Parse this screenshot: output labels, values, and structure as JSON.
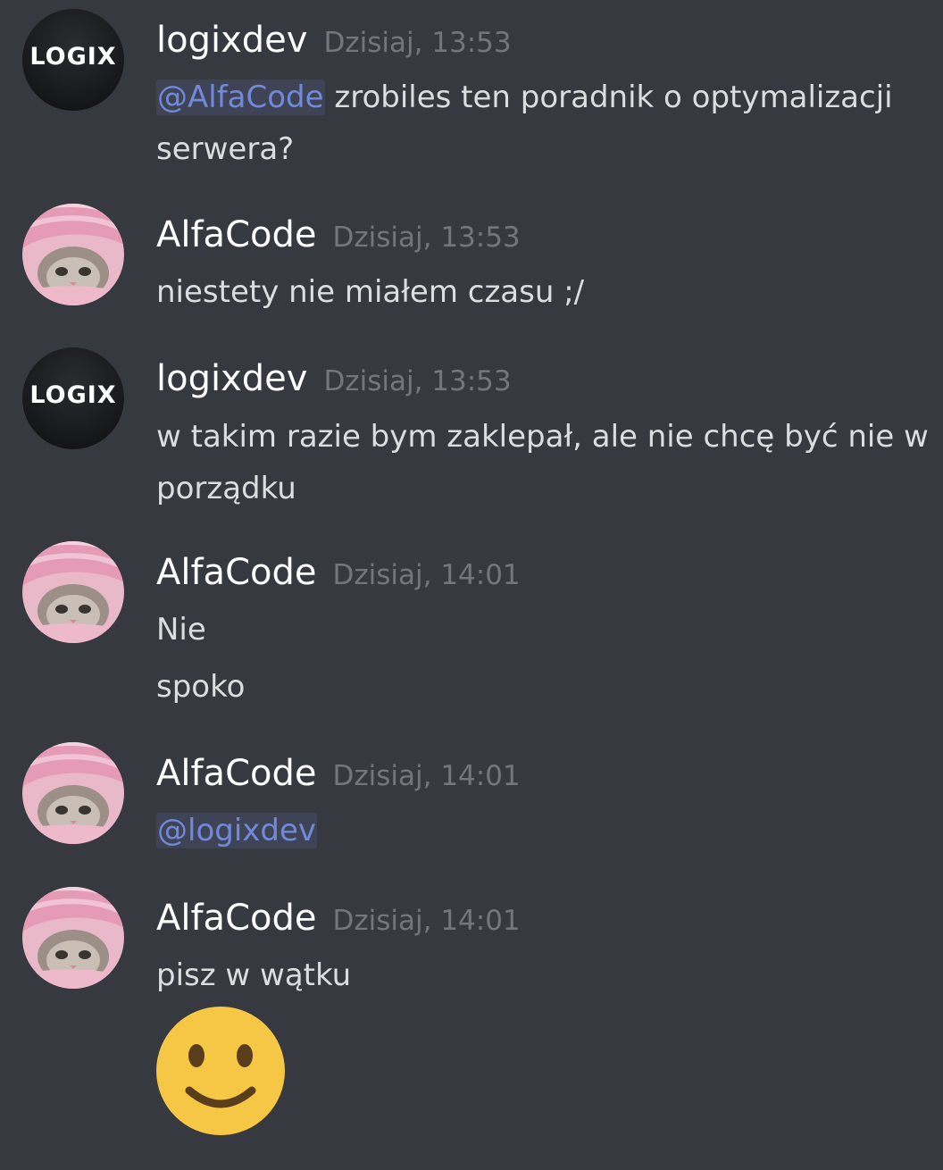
{
  "messages": [
    {
      "author": "logixdev",
      "time": "Dzisiaj, 13:53",
      "avatar": "logix-logo",
      "logo_text": "LOGIX",
      "lines": [
        {
          "mention": "@AlfaCode",
          "text": " zrobiles ten poradnik o optymalizacji"
        },
        {
          "text": "serwera?"
        }
      ]
    },
    {
      "author": "AlfaCode",
      "time": "Dzisiaj, 13:53",
      "avatar": "kitten",
      "lines": [
        {
          "text": "niestety nie miałem czasu ;/"
        }
      ]
    },
    {
      "author": "logixdev",
      "time": "Dzisiaj, 13:53",
      "avatar": "logix-logo",
      "logo_text": "LOGIX",
      "lines": [
        {
          "text": "w takim razie bym zaklepał, ale nie chcę być nie w"
        },
        {
          "text": "porządku"
        }
      ]
    },
    {
      "author": "AlfaCode",
      "time": "Dzisiaj, 14:01",
      "avatar": "kitten",
      "lines": [
        {
          "text": "Nie"
        },
        {
          "text": "spoko"
        }
      ]
    },
    {
      "author": "AlfaCode",
      "time": "Dzisiaj, 14:01",
      "avatar": "kitten",
      "lines": [
        {
          "mention": "@logixdev"
        }
      ]
    },
    {
      "author": "AlfaCode",
      "time": "Dzisiaj, 14:01",
      "avatar": "kitten",
      "lines": [
        {
          "text": "pisz w wątku"
        }
      ],
      "emoji": "slightly-smiling-face-icon"
    }
  ],
  "colors": {
    "background": "#36393f",
    "username": "#ffffff",
    "timestamp": "#72767d",
    "text": "#dcddde",
    "mention": "#7289da",
    "emoji": "#f6c744"
  }
}
